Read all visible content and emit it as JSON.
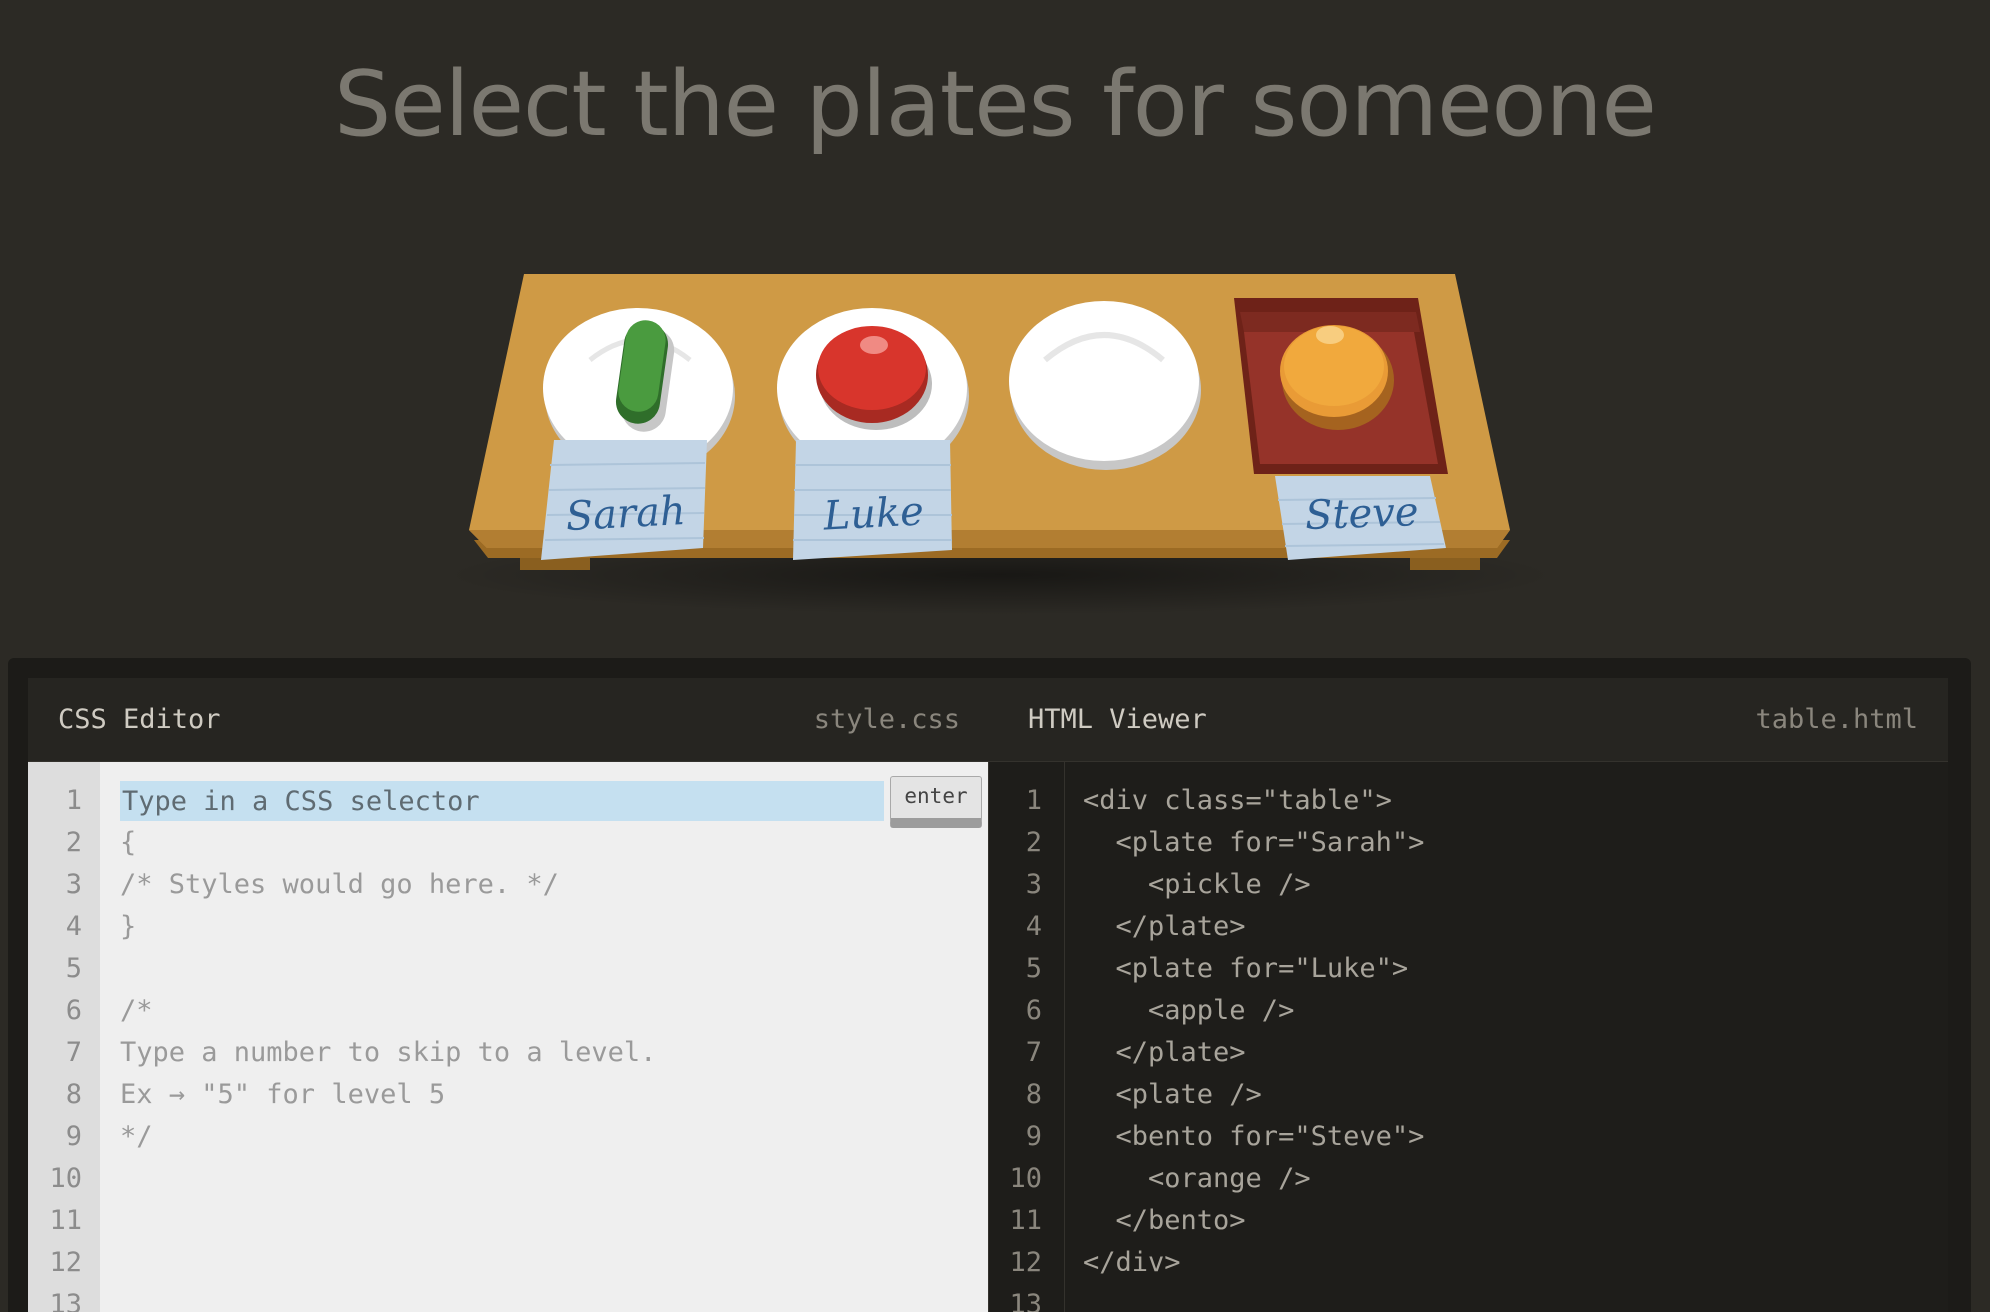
{
  "instruction": "Select the plates for someone",
  "table": {
    "tags": [
      "Sarah",
      "Luke",
      "Steve"
    ]
  },
  "css_editor": {
    "title": "CSS Editor",
    "filename": "style.css",
    "input_placeholder": "Type in a CSS selector",
    "enter_label": "enter",
    "line_numbers": [
      "1",
      "2",
      "3",
      "4",
      "5",
      "6",
      "7",
      "8",
      "9",
      "10",
      "11",
      "12",
      "13"
    ],
    "lines": [
      "",
      "{",
      "/* Styles would go here. */",
      "}",
      "",
      "/*",
      "Type a number to skip to a level.",
      "Ex → \"5\" for level 5",
      "*/"
    ]
  },
  "html_viewer": {
    "title": "HTML Viewer",
    "filename": "table.html",
    "line_numbers": [
      "1",
      "2",
      "3",
      "4",
      "5",
      "6",
      "7",
      "8",
      "9",
      "10",
      "11",
      "12",
      "13"
    ],
    "lines": [
      "<div class=\"table\">",
      "  <plate for=\"Sarah\">",
      "    <pickle />",
      "  </plate>",
      "  <plate for=\"Luke\">",
      "    <apple />",
      "  </plate>",
      "  <plate />",
      "  <bento for=\"Steve\">",
      "    <orange />",
      "  </bento>",
      "</div>"
    ]
  }
}
